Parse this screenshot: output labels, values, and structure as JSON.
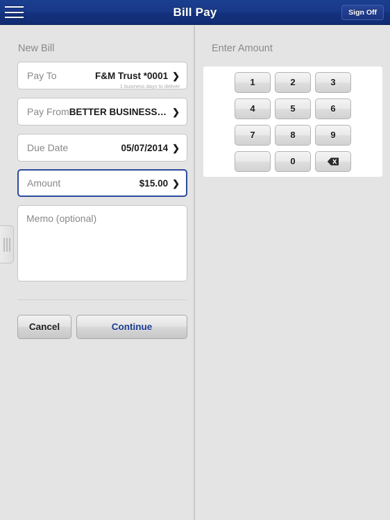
{
  "navbar": {
    "menu_icon": "hamburger-menu-icon",
    "title": "Bill Pay",
    "signoff_label": "Sign Off"
  },
  "left_panel": {
    "section_title": "New Bill",
    "fields": [
      {
        "label": "Pay To",
        "value": "F&M Trust *0001",
        "subnote": "1 business days to deliver",
        "chevron": "❯",
        "focused": false
      },
      {
        "label": "Pay From",
        "value": "BETTER BUSINESS CHECKI...",
        "subnote": "",
        "chevron": "❯",
        "focused": false
      },
      {
        "label": "Due Date",
        "value": "05/07/2014",
        "subnote": "",
        "chevron": "❯",
        "focused": false
      },
      {
        "label": "Amount",
        "value": "$15.00",
        "subnote": "",
        "chevron": "❯",
        "focused": true
      }
    ],
    "memo": {
      "placeholder": "Memo (optional)",
      "value": ""
    },
    "buttons": {
      "cancel_label": "Cancel",
      "continue_label": "Continue"
    }
  },
  "right_panel": {
    "section_title": "Enter Amount",
    "keypad": [
      {
        "name": "key-1",
        "label": "1",
        "type": "digit"
      },
      {
        "name": "key-2",
        "label": "2",
        "type": "digit"
      },
      {
        "name": "key-3",
        "label": "3",
        "type": "digit"
      },
      {
        "name": "key-4",
        "label": "4",
        "type": "digit"
      },
      {
        "name": "key-5",
        "label": "5",
        "type": "digit"
      },
      {
        "name": "key-6",
        "label": "6",
        "type": "digit"
      },
      {
        "name": "key-7",
        "label": "7",
        "type": "digit"
      },
      {
        "name": "key-8",
        "label": "8",
        "type": "digit"
      },
      {
        "name": "key-9",
        "label": "9",
        "type": "digit"
      },
      {
        "name": "key-blank",
        "label": "",
        "type": "blank"
      },
      {
        "name": "key-0",
        "label": "0",
        "type": "digit"
      },
      {
        "name": "key-backspace",
        "label": "",
        "type": "backspace"
      }
    ]
  },
  "drag_handle": {
    "name": "panel-drag-handle"
  },
  "colors": {
    "navbar_blue": "#16357f",
    "accent_blue": "#1b3a8f",
    "focus_border": "#2b4a9b",
    "page_background": "#e4e4e4",
    "card_white": "#ffffff",
    "label_gray": "#888888"
  }
}
